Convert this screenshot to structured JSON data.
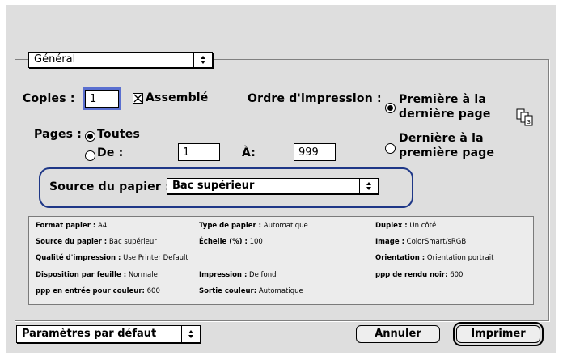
{
  "panel_menu": {
    "value": "Général"
  },
  "copies": {
    "label": "Copies :",
    "value": "1"
  },
  "collate": {
    "label": "Assemblé",
    "checked": true
  },
  "order": {
    "label": "Ordre d'impression :",
    "option1_line1": "Première à la",
    "option1_line2": "dernière page",
    "option2_line1": "Dernière à la",
    "option2_line2": "première page",
    "selected": 1,
    "icon": "page-order-icon"
  },
  "pages": {
    "label": "Pages :",
    "all_label": "Toutes",
    "from_label": "De :",
    "to_label": "À:",
    "from_value": "1",
    "to_value": "999",
    "selected": "all"
  },
  "paper_source": {
    "label": "Source du papier :",
    "value": "Bac supérieur"
  },
  "summary": {
    "col1": [
      {
        "k": "Format papier :",
        "v": "A4"
      },
      {
        "k": "Source du papier :",
        "v": "Bac supérieur"
      },
      {
        "k": "Qualité d'impression :",
        "v": "Use Printer Default"
      },
      {
        "k": "Disposition par feuille :",
        "v": "Normale"
      },
      {
        "k": "ppp en entrée pour couleur:",
        "v": "600"
      }
    ],
    "col2": [
      {
        "k": "Type de papier :",
        "v": "Automatique"
      },
      {
        "k": "Échelle (%) :",
        "v": "100"
      },
      {
        "k": "",
        "v": ""
      },
      {
        "k": "Impression :",
        "v": "De fond"
      },
      {
        "k": "Sortie couleur:",
        "v": "Automatique"
      }
    ],
    "col3": [
      {
        "k": "Duplex :",
        "v": "Un côté"
      },
      {
        "k": "Image :",
        "v": "ColorSmart/sRGB"
      },
      {
        "k": "Orientation :",
        "v": "Orientation portrait"
      },
      {
        "k": "ppp de rendu noir:",
        "v": "600"
      }
    ]
  },
  "bottom": {
    "presets": "Paramètres par défaut",
    "cancel": "Annuler",
    "print": "Imprimer"
  },
  "colors": {
    "highlight": "#1e3787",
    "focus_ring": "#5a6fd0",
    "dialog_bg": "#dedede"
  }
}
